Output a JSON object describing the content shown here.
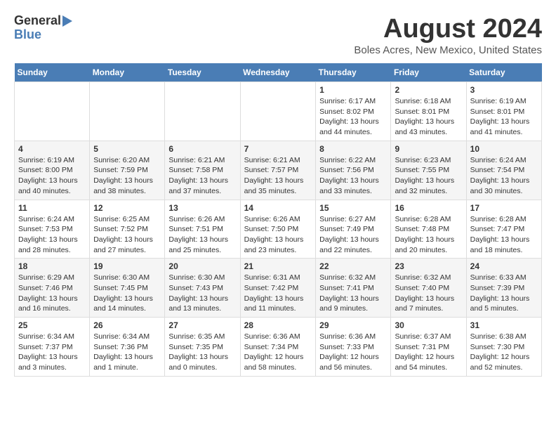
{
  "header": {
    "logo_line1": "General",
    "logo_line2": "Blue",
    "month_year": "August 2024",
    "location": "Boles Acres, New Mexico, United States"
  },
  "weekdays": [
    "Sunday",
    "Monday",
    "Tuesday",
    "Wednesday",
    "Thursday",
    "Friday",
    "Saturday"
  ],
  "weeks": [
    [
      {
        "day": "",
        "info": ""
      },
      {
        "day": "",
        "info": ""
      },
      {
        "day": "",
        "info": ""
      },
      {
        "day": "",
        "info": ""
      },
      {
        "day": "1",
        "info": "Sunrise: 6:17 AM\nSunset: 8:02 PM\nDaylight: 13 hours\nand 44 minutes."
      },
      {
        "day": "2",
        "info": "Sunrise: 6:18 AM\nSunset: 8:01 PM\nDaylight: 13 hours\nand 43 minutes."
      },
      {
        "day": "3",
        "info": "Sunrise: 6:19 AM\nSunset: 8:01 PM\nDaylight: 13 hours\nand 41 minutes."
      }
    ],
    [
      {
        "day": "4",
        "info": "Sunrise: 6:19 AM\nSunset: 8:00 PM\nDaylight: 13 hours\nand 40 minutes."
      },
      {
        "day": "5",
        "info": "Sunrise: 6:20 AM\nSunset: 7:59 PM\nDaylight: 13 hours\nand 38 minutes."
      },
      {
        "day": "6",
        "info": "Sunrise: 6:21 AM\nSunset: 7:58 PM\nDaylight: 13 hours\nand 37 minutes."
      },
      {
        "day": "7",
        "info": "Sunrise: 6:21 AM\nSunset: 7:57 PM\nDaylight: 13 hours\nand 35 minutes."
      },
      {
        "day": "8",
        "info": "Sunrise: 6:22 AM\nSunset: 7:56 PM\nDaylight: 13 hours\nand 33 minutes."
      },
      {
        "day": "9",
        "info": "Sunrise: 6:23 AM\nSunset: 7:55 PM\nDaylight: 13 hours\nand 32 minutes."
      },
      {
        "day": "10",
        "info": "Sunrise: 6:24 AM\nSunset: 7:54 PM\nDaylight: 13 hours\nand 30 minutes."
      }
    ],
    [
      {
        "day": "11",
        "info": "Sunrise: 6:24 AM\nSunset: 7:53 PM\nDaylight: 13 hours\nand 28 minutes."
      },
      {
        "day": "12",
        "info": "Sunrise: 6:25 AM\nSunset: 7:52 PM\nDaylight: 13 hours\nand 27 minutes."
      },
      {
        "day": "13",
        "info": "Sunrise: 6:26 AM\nSunset: 7:51 PM\nDaylight: 13 hours\nand 25 minutes."
      },
      {
        "day": "14",
        "info": "Sunrise: 6:26 AM\nSunset: 7:50 PM\nDaylight: 13 hours\nand 23 minutes."
      },
      {
        "day": "15",
        "info": "Sunrise: 6:27 AM\nSunset: 7:49 PM\nDaylight: 13 hours\nand 22 minutes."
      },
      {
        "day": "16",
        "info": "Sunrise: 6:28 AM\nSunset: 7:48 PM\nDaylight: 13 hours\nand 20 minutes."
      },
      {
        "day": "17",
        "info": "Sunrise: 6:28 AM\nSunset: 7:47 PM\nDaylight: 13 hours\nand 18 minutes."
      }
    ],
    [
      {
        "day": "18",
        "info": "Sunrise: 6:29 AM\nSunset: 7:46 PM\nDaylight: 13 hours\nand 16 minutes."
      },
      {
        "day": "19",
        "info": "Sunrise: 6:30 AM\nSunset: 7:45 PM\nDaylight: 13 hours\nand 14 minutes."
      },
      {
        "day": "20",
        "info": "Sunrise: 6:30 AM\nSunset: 7:43 PM\nDaylight: 13 hours\nand 13 minutes."
      },
      {
        "day": "21",
        "info": "Sunrise: 6:31 AM\nSunset: 7:42 PM\nDaylight: 13 hours\nand 11 minutes."
      },
      {
        "day": "22",
        "info": "Sunrise: 6:32 AM\nSunset: 7:41 PM\nDaylight: 13 hours\nand 9 minutes."
      },
      {
        "day": "23",
        "info": "Sunrise: 6:32 AM\nSunset: 7:40 PM\nDaylight: 13 hours\nand 7 minutes."
      },
      {
        "day": "24",
        "info": "Sunrise: 6:33 AM\nSunset: 7:39 PM\nDaylight: 13 hours\nand 5 minutes."
      }
    ],
    [
      {
        "day": "25",
        "info": "Sunrise: 6:34 AM\nSunset: 7:37 PM\nDaylight: 13 hours\nand 3 minutes."
      },
      {
        "day": "26",
        "info": "Sunrise: 6:34 AM\nSunset: 7:36 PM\nDaylight: 13 hours\nand 1 minute."
      },
      {
        "day": "27",
        "info": "Sunrise: 6:35 AM\nSunset: 7:35 PM\nDaylight: 13 hours\nand 0 minutes."
      },
      {
        "day": "28",
        "info": "Sunrise: 6:36 AM\nSunset: 7:34 PM\nDaylight: 12 hours\nand 58 minutes."
      },
      {
        "day": "29",
        "info": "Sunrise: 6:36 AM\nSunset: 7:33 PM\nDaylight: 12 hours\nand 56 minutes."
      },
      {
        "day": "30",
        "info": "Sunrise: 6:37 AM\nSunset: 7:31 PM\nDaylight: 12 hours\nand 54 minutes."
      },
      {
        "day": "31",
        "info": "Sunrise: 6:38 AM\nSunset: 7:30 PM\nDaylight: 12 hours\nand 52 minutes."
      }
    ]
  ]
}
